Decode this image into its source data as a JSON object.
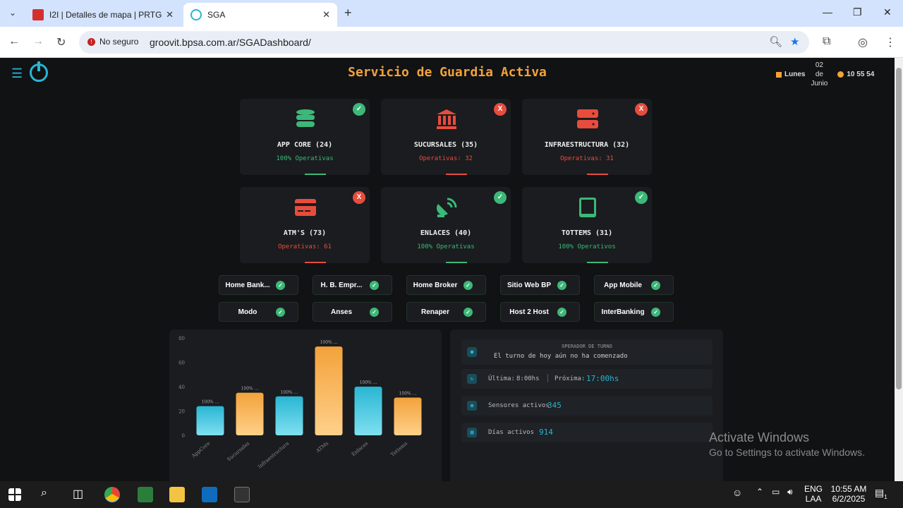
{
  "browser": {
    "tabs": [
      {
        "title": "I2I | Detalles de mapa | PRTG Ne"
      },
      {
        "title": "SGA"
      }
    ],
    "security_label": "No seguro",
    "url": "groovit.bpsa.com.ar/SGADashboard/"
  },
  "app": {
    "title": "Servicio de Guardia Activa",
    "day_name": "Lunes",
    "day_num": "02",
    "day_de": "de",
    "month": "Junio",
    "time": "10 55 54"
  },
  "cards": [
    {
      "name": "APP CORE (24)",
      "status": "100% Operativas",
      "ok": true,
      "icon": "database-icon",
      "color": "#3cb878",
      "badge": "✓"
    },
    {
      "name": "SUCURSALES (35)",
      "status": "Operativas: 32",
      "ok": false,
      "icon": "bank-icon",
      "color": "#e84c3d",
      "badge": "X"
    },
    {
      "name": "INFRAESTRUCTURA (32)",
      "status": "Operativas: 31",
      "ok": false,
      "icon": "server-icon",
      "color": "#e84c3d",
      "badge": "X"
    },
    {
      "name": "ATM'S (73)",
      "status": "Operativas: 61",
      "ok": false,
      "icon": "credit-card-icon",
      "color": "#e84c3d",
      "badge": "X"
    },
    {
      "name": "ENLACES (40)",
      "status": "100% Operativas",
      "ok": true,
      "icon": "satellite-dish-icon",
      "color": "#3cb878",
      "badge": "✓"
    },
    {
      "name": "TOTTEMS (31)",
      "status": "100% Operativos",
      "ok": true,
      "icon": "tablet-icon",
      "color": "#3cb878",
      "badge": "✓"
    }
  ],
  "services": [
    {
      "label": "Home Bank..."
    },
    {
      "label": "H. B. Empr..."
    },
    {
      "label": "Home Broker"
    },
    {
      "label": "Sitio Web BP"
    },
    {
      "label": "App Mobile"
    },
    {
      "label": "Modo"
    },
    {
      "label": "Anses"
    },
    {
      "label": "Renaper"
    },
    {
      "label": "Host 2 Host"
    },
    {
      "label": "InterBanking"
    }
  ],
  "chart_data": {
    "type": "bar",
    "categories": [
      "AppCore",
      "Sucursales",
      "Infraestructura",
      "ATMs",
      "Enlaces",
      "Tottems"
    ],
    "values": [
      24,
      35,
      32,
      73,
      40,
      31
    ],
    "data_labels": [
      "100% ...",
      "100% ...",
      "100% ...",
      "100% ...",
      "100% ...",
      "100% ..."
    ],
    "colors": [
      "#29b6d3",
      "#f3a23b",
      "#29b6d3",
      "#f3a23b",
      "#29b6d3",
      "#f3a23b"
    ],
    "yticks": [
      "0",
      "20",
      "40",
      "60",
      "80"
    ],
    "ylim": [
      0,
      80
    ],
    "title": "",
    "xlabel": "",
    "ylabel": ""
  },
  "info": {
    "operator_heading": "OPERADOR DE TURNO",
    "operator_msg": "El turno de hoy aún no ha comenzado",
    "ultima_label": "Última:",
    "ultima_value": "8:00hs",
    "proxima_label": "Próxima:",
    "proxima_value": "17:00hs",
    "sensores_label": "Sensores activos",
    "sensores_value": "345",
    "dias_label": "Días activos",
    "dias_value": "914"
  },
  "watermark": {
    "line1": "Activate Windows",
    "line2": "Go to Settings to activate Windows."
  },
  "taskbar": {
    "lang1": "ENG",
    "lang2": "LAA",
    "time": "10:55 AM",
    "date": "6/2/2025",
    "notif_count": "1"
  }
}
